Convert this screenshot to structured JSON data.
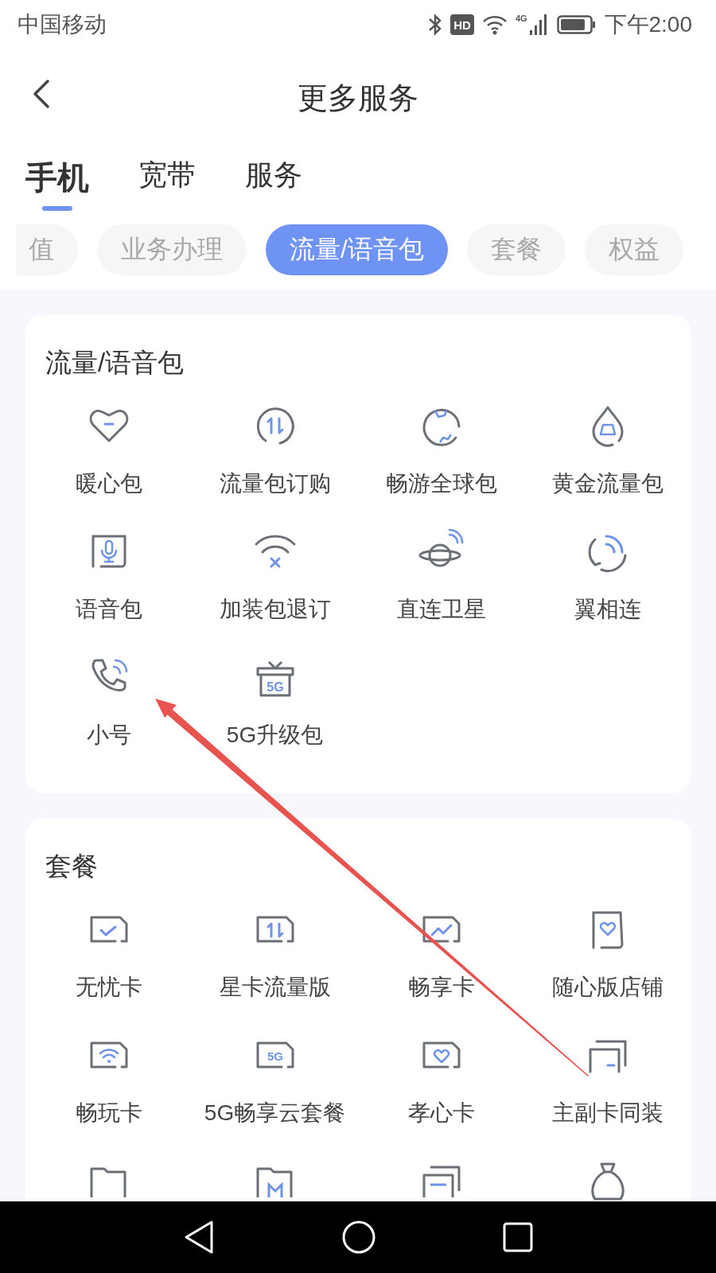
{
  "status_bar": {
    "carrier": "中国移动",
    "hd_badge": "HD",
    "network": "4G",
    "time": "下午2:00"
  },
  "header": {
    "title": "更多服务"
  },
  "tabs": [
    {
      "label": "手机",
      "selected": true
    },
    {
      "label": "宽带",
      "selected": false
    },
    {
      "label": "服务",
      "selected": false
    }
  ],
  "chips": [
    {
      "label": "值",
      "selected": false
    },
    {
      "label": "业务办理",
      "selected": false
    },
    {
      "label": "流量/语音包",
      "selected": true
    },
    {
      "label": "套餐",
      "selected": false
    },
    {
      "label": "权益",
      "selected": false
    }
  ],
  "sections": [
    {
      "title": "流量/语音包",
      "items": [
        {
          "kind": "full",
          "label": "暖心包"
        },
        {
          "kind": "full",
          "label": "流量包订购"
        },
        {
          "kind": "full",
          "label": "畅游全球包"
        },
        {
          "kind": "full",
          "label": "黄金流量包"
        },
        {
          "kind": "full",
          "label": "语音包"
        },
        {
          "kind": "full",
          "label": "加装包退订"
        },
        {
          "kind": "full",
          "label": "直连卫星"
        },
        {
          "kind": "full",
          "label": "翼相连"
        },
        {
          "kind": "full",
          "label": "小号"
        },
        {
          "kind": "full",
          "label": "5G升级包",
          "icon_text": "5G"
        }
      ]
    },
    {
      "title": "套餐",
      "items": [
        {
          "kind": "full",
          "label": "无忧卡"
        },
        {
          "kind": "full",
          "label": "星卡流量版"
        },
        {
          "kind": "full",
          "label": "畅享卡"
        },
        {
          "kind": "full",
          "label": "随心版店铺"
        },
        {
          "kind": "full",
          "label": "畅玩卡"
        },
        {
          "kind": "full",
          "label": "5G畅享云套餐",
          "icon_text": "5G"
        },
        {
          "kind": "full",
          "label": "孝心卡"
        },
        {
          "kind": "full",
          "label": "主副卡同装"
        },
        {
          "kind": "cut"
        },
        {
          "kind": "cut"
        },
        {
          "kind": "cut"
        },
        {
          "kind": "cut"
        }
      ]
    }
  ]
}
